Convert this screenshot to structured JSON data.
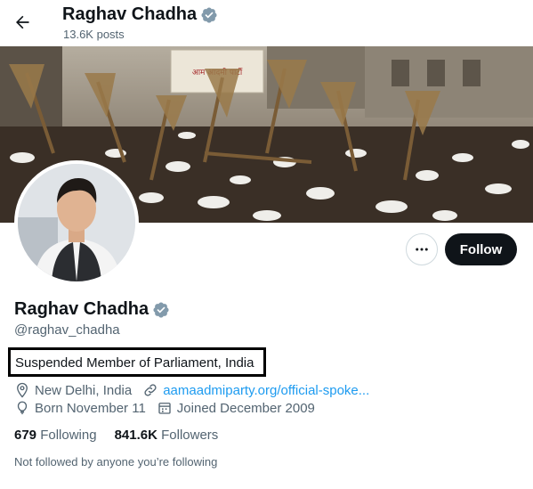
{
  "header": {
    "name": "Raghav Chadha",
    "posts": "13.6K posts"
  },
  "banner": {
    "signs": [
      "आम आदमी पार्टी"
    ]
  },
  "actions": {
    "follow_label": "Follow"
  },
  "profile": {
    "name": "Raghav Chadha",
    "handle": "@raghav_chadha",
    "bio": "Suspended Member of Parliament, India",
    "location": "New Delhi, India",
    "website": "aamaadmiparty.org/official-spoke...",
    "born": "Born November 11",
    "joined": "Joined December 2009"
  },
  "stats": {
    "following_count": "679",
    "following_label": "Following",
    "followers_count": "841.6K",
    "followers_label": "Followers"
  },
  "footer": {
    "not_followed": "Not followed by anyone you’re following"
  },
  "colors": {
    "accent": "#1d9bf0",
    "verified": "#829aab",
    "text": "#0f1419",
    "muted": "#536471"
  }
}
